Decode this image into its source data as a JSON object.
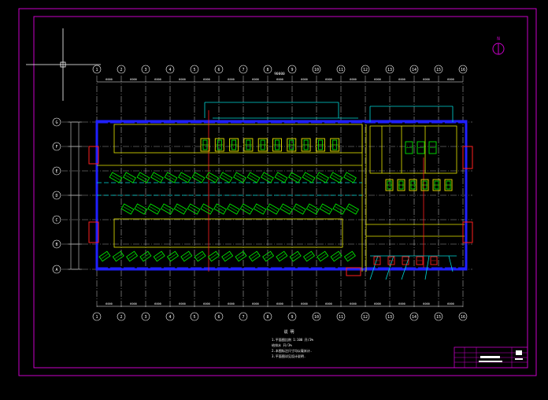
{
  "drawing": {
    "column_grid_labels": [
      "1",
      "2",
      "3",
      "4",
      "5",
      "6",
      "7",
      "8",
      "9",
      "10",
      "11",
      "12",
      "13",
      "14",
      "15",
      "16"
    ],
    "row_grid_labels": [
      "G",
      "F",
      "E",
      "D",
      "C",
      "B",
      "A"
    ],
    "top_dims": [
      "6000",
      "6000",
      "6000",
      "6000",
      "6000",
      "6000",
      "6000",
      "6000",
      "6000",
      "6000",
      "6000",
      "6000",
      "6000",
      "6000",
      "6000"
    ],
    "bottom_dims": [
      "6000",
      "6000",
      "6000",
      "6000",
      "6000",
      "6000",
      "6000",
      "6000",
      "6000",
      "6000",
      "6000",
      "6000",
      "6000",
      "6000",
      "6000"
    ],
    "overall_dim": "90000",
    "notes_title": "说 明",
    "notes": [
      "1.平面图比例 1:100 开/3%",
      "   给排水 开/3%",
      "2.本图标注尺寸均以毫米计.",
      "3.平面图详见设计说明."
    ],
    "north_symbol": "N"
  },
  "colors": {
    "background": "#000000",
    "frame": "#c800c8",
    "axis": "#ffffff",
    "wall": "#2020ff",
    "yellow": "#e6e600",
    "green": "#00e600",
    "cyan": "#00d7d7",
    "red": "#ff2020"
  },
  "title_block": {
    "rows": [
      "工程名称",
      "图名",
      "设计",
      "审核"
    ]
  }
}
